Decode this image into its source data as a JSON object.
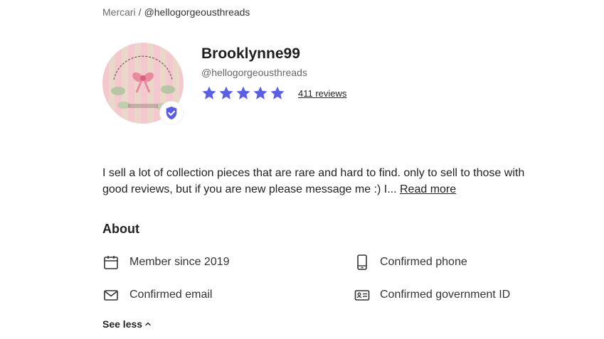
{
  "breadcrumb": {
    "root": "Mercari",
    "separator": "/",
    "current": "@hellogorgeousthreads"
  },
  "profile": {
    "username": "Brooklynne99",
    "handle": "@hellogorgeousthreads",
    "rating": 5,
    "reviews_label": "411 reviews",
    "avatar_icon": "shop-logo",
    "verified_icon": "shield-check-icon"
  },
  "bio": {
    "text": "I sell a lot of collection pieces that are rare and hard to find. only to sell to those with good reviews, but if you are new please message me :) I...",
    "read_more": "Read more"
  },
  "about": {
    "heading": "About",
    "member_since": "Member since 2019",
    "confirmed_phone": "Confirmed phone",
    "confirmed_email": "Confirmed email",
    "confirmed_gov_id": "Confirmed government ID",
    "see_less": "See less"
  },
  "colors": {
    "star": "#5b5ee3",
    "badge": "#5b5ee3",
    "text": "#222222"
  }
}
